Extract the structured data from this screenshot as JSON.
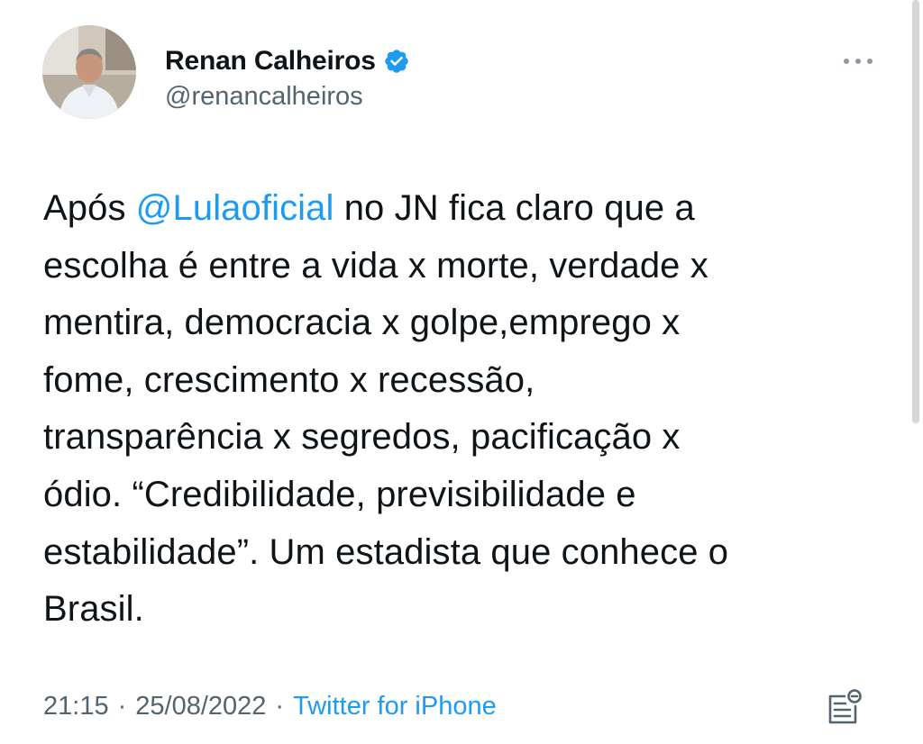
{
  "author": {
    "display_name": "Renan Calheiros",
    "handle": "@renancalheiros",
    "verified": true
  },
  "tweet": {
    "lines": [
      {
        "pre": "Após ",
        "mention": "@Lulaoficial",
        "post": " no JN fica claro que a"
      },
      {
        "text": "escolha é entre a vida x morte, verdade x"
      },
      {
        "text": "mentira, democracia x golpe,emprego x"
      },
      {
        "text": "fome, crescimento x recessão,"
      },
      {
        "text": "transparência x segredos, pacificação x"
      },
      {
        "text": "ódio. “Credibilidade, previsibilidade e"
      },
      {
        "text": "estabilidade”. Um estadista que conhece o"
      },
      {
        "text": "Brasil."
      }
    ]
  },
  "meta": {
    "time": "21:15",
    "separator": "·",
    "date": "25/08/2022",
    "source": "Twitter for iPhone"
  },
  "icons": {
    "verified": "verified-badge-icon",
    "more": "more-options-icon",
    "analytics": "tweet-analytics-icon"
  },
  "colors": {
    "accent": "#1d9bf0",
    "text": "#0f1419",
    "secondary": "#536471"
  }
}
